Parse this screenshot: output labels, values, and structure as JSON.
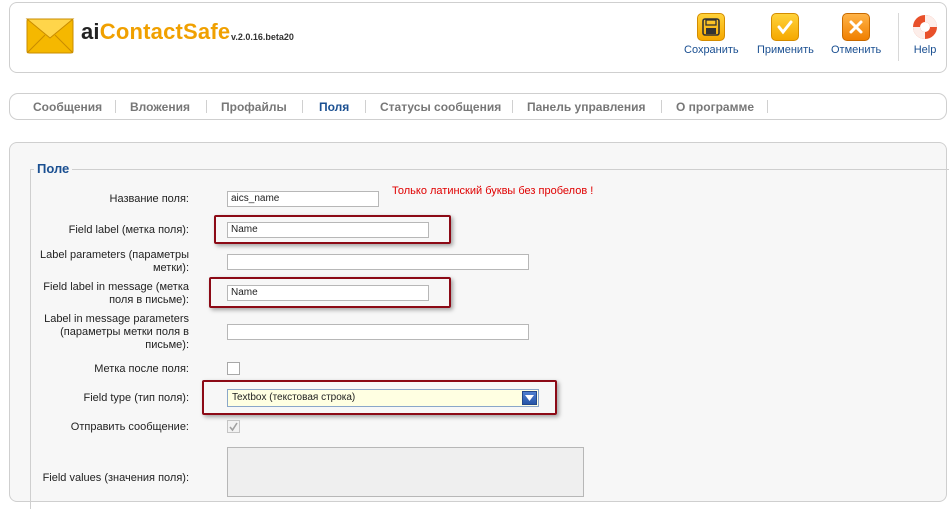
{
  "app": {
    "title_prefix": "ai",
    "title_main": "ContactSafe",
    "version": "v.2.0.16.beta20"
  },
  "toolbar": {
    "save": "Сохранить",
    "apply": "Применить",
    "cancel": "Отменить",
    "help": "Help"
  },
  "tabs": [
    {
      "label": "Сообщения"
    },
    {
      "label": "Вложения"
    },
    {
      "label": "Профайлы"
    },
    {
      "label": "Поля"
    },
    {
      "label": "Статусы сообщения"
    },
    {
      "label": "Панель управления"
    },
    {
      "label": "О программе"
    }
  ],
  "active_tab": "Поля",
  "form": {
    "legend": "Поле",
    "field_name_label": "Название поля:",
    "field_name_value": "aics_name",
    "field_name_hint": "Только латинский буквы без пробелов !",
    "field_label_label": "Field label (метка поля):",
    "field_label_value": "Name",
    "label_params_line1": "Label parameters (параметры",
    "label_params_line2": "метки):",
    "label_params_value": "",
    "msg_label_line1": "Field label in message (метка",
    "msg_label_line2": "поля в письме):",
    "msg_label_value": "Name",
    "msg_params_line1": "Label in message parameters",
    "msg_params_line2": "(параметры метки поля в",
    "msg_params_line3": "письме):",
    "msg_params_value": "",
    "label_after_label": "Метка после поля:",
    "field_type_label": "Field type (тип поля):",
    "field_type_value": "Textbox (текстовая строка)",
    "send_message_label": "Отправить сообщение:",
    "field_values_label": "Field values (значения поля):"
  },
  "colors": {
    "accent": "#1a4f91",
    "logo_orange": "#f0a000",
    "hint_red": "#e00000",
    "highlight": "#8c0a16"
  }
}
